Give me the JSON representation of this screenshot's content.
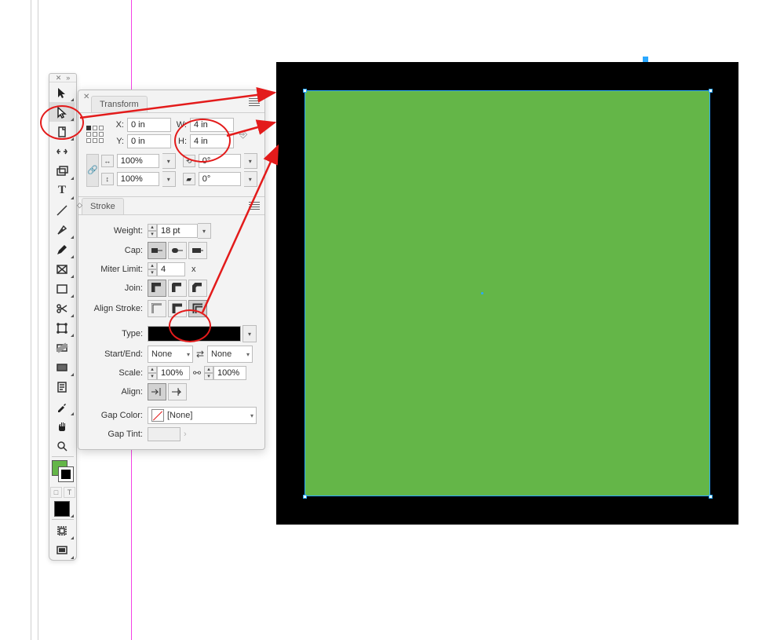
{
  "panel": {
    "transform_tab": "Transform",
    "x_label": "X:",
    "x_value": "0 in",
    "y_label": "Y:",
    "y_value": "0 in",
    "w_label": "W:",
    "w_value": "4 in",
    "h_label": "H:",
    "h_value": "4 in",
    "scale_w": "100%",
    "scale_h": "100%",
    "rotate": "0°",
    "shear": "0°",
    "stroke_tab": "Stroke",
    "weight_label": "Weight:",
    "weight_value": "18 pt",
    "cap_label": "Cap:",
    "miter_label": "Miter Limit:",
    "miter_value": "4",
    "miter_x": "x",
    "join_label": "Join:",
    "align_label": "Align Stroke:",
    "type_label": "Type:",
    "startend_label": "Start/End:",
    "start_value": "None",
    "end_value": "None",
    "scale_label": "Scale:",
    "scale_start": "100%",
    "scale_end": "100%",
    "align_panel_label": "Align:",
    "gap_color_label": "Gap Color:",
    "gap_color_value": "[None]",
    "gap_tint_label": "Gap Tint:"
  },
  "toolbar": {
    "formatting_container": "□",
    "formatting_text": "T"
  },
  "canvas": {
    "fill_color": "#64b648",
    "stroke_color": "#000000"
  }
}
